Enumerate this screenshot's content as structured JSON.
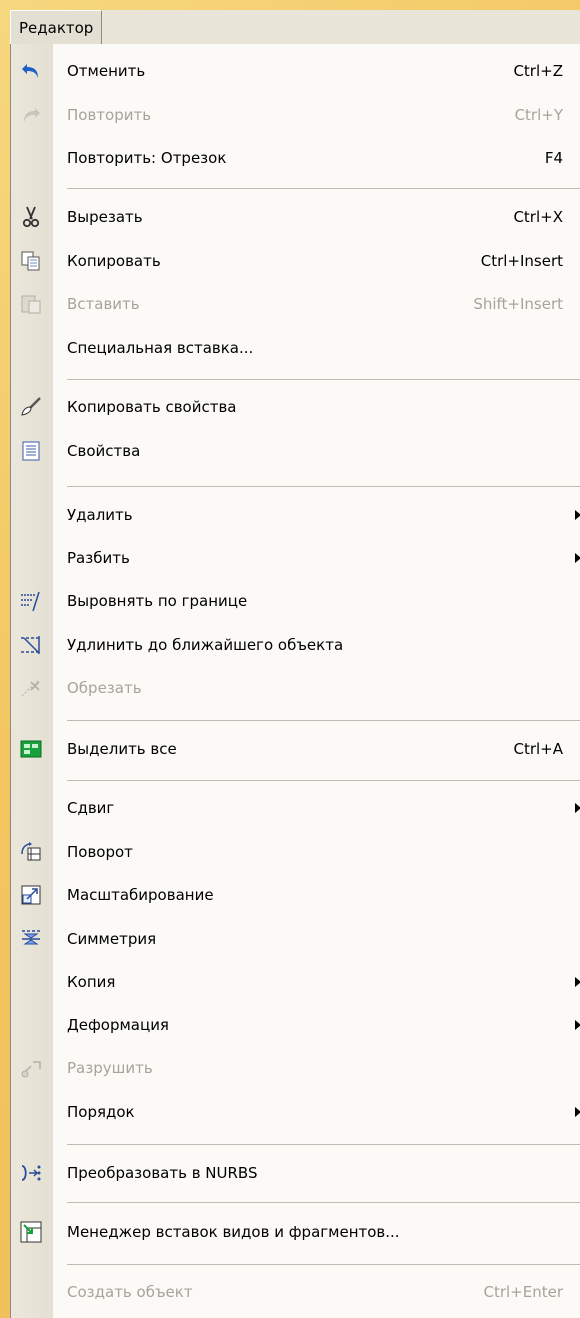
{
  "menubar": {
    "title": "Редактор"
  },
  "colors": {
    "background": "#f3c661",
    "menu": "#fbfaf6",
    "gutter": "#e6e2d6",
    "disabled_text": "#a7a39a",
    "icon_blue": "#1f5fc8",
    "icon_green": "#19a13b"
  },
  "items": [
    {
      "label": "Отменить",
      "shortcut": "Ctrl+Z",
      "icon": "undo-icon",
      "disabled": false,
      "submenu": false
    },
    {
      "label": "Повторить",
      "shortcut": "Ctrl+Y",
      "icon": "redo-icon",
      "disabled": true,
      "submenu": false
    },
    {
      "label": "Повторить: Отрезок",
      "shortcut": "F4",
      "icon": "",
      "disabled": false,
      "submenu": false
    },
    {
      "label": "Вырезать",
      "shortcut": "Ctrl+X",
      "icon": "scissors-icon",
      "disabled": false,
      "submenu": false
    },
    {
      "label": "Копировать",
      "shortcut": "Ctrl+Insert",
      "icon": "copy-icon",
      "disabled": false,
      "submenu": false
    },
    {
      "label": "Вставить",
      "shortcut": "Shift+Insert",
      "icon": "paste-icon",
      "disabled": true,
      "submenu": false
    },
    {
      "label": "Специальная вставка...",
      "shortcut": "",
      "icon": "",
      "disabled": false,
      "submenu": false
    },
    {
      "label": "Копировать свойства",
      "shortcut": "",
      "icon": "brush-icon",
      "disabled": false,
      "submenu": false
    },
    {
      "label": "Свойства",
      "shortcut": "",
      "icon": "properties-icon",
      "disabled": false,
      "submenu": false
    },
    {
      "label": "Удалить",
      "shortcut": "",
      "icon": "",
      "disabled": false,
      "submenu": true
    },
    {
      "label": "Разбить",
      "shortcut": "",
      "icon": "",
      "disabled": false,
      "submenu": true
    },
    {
      "label": "Выровнять по границе",
      "shortcut": "",
      "icon": "align-border-icon",
      "disabled": false,
      "submenu": false
    },
    {
      "label": "Удлинить до ближайшего объекта",
      "shortcut": "",
      "icon": "extend-icon",
      "disabled": false,
      "submenu": false
    },
    {
      "label": "Обрезать",
      "shortcut": "",
      "icon": "trim-icon",
      "disabled": true,
      "submenu": false
    },
    {
      "label": "Выделить все",
      "shortcut": "Ctrl+A",
      "icon": "select-all-icon",
      "disabled": false,
      "submenu": false
    },
    {
      "label": "Сдвиг",
      "shortcut": "",
      "icon": "",
      "disabled": false,
      "submenu": true
    },
    {
      "label": "Поворот",
      "shortcut": "",
      "icon": "rotate-icon",
      "disabled": false,
      "submenu": false
    },
    {
      "label": "Масштабирование",
      "shortcut": "",
      "icon": "scale-icon",
      "disabled": false,
      "submenu": false
    },
    {
      "label": "Симметрия",
      "shortcut": "",
      "icon": "symmetry-icon",
      "disabled": false,
      "submenu": false
    },
    {
      "label": "Копия",
      "shortcut": "",
      "icon": "",
      "disabled": false,
      "submenu": true
    },
    {
      "label": "Деформация",
      "shortcut": "",
      "icon": "",
      "disabled": false,
      "submenu": true
    },
    {
      "label": "Разрушить",
      "shortcut": "",
      "icon": "explode-icon",
      "disabled": true,
      "submenu": false
    },
    {
      "label": "Порядок",
      "shortcut": "",
      "icon": "",
      "disabled": false,
      "submenu": true
    },
    {
      "label": "Преобразовать в NURBS",
      "shortcut": "",
      "icon": "nurbs-icon",
      "disabled": false,
      "submenu": false
    },
    {
      "label": "Менеджер вставок видов и фрагментов...",
      "shortcut": "",
      "icon": "insert-manager-icon",
      "disabled": false,
      "submenu": false
    },
    {
      "label": "Создать объект",
      "shortcut": "Ctrl+Enter",
      "icon": "",
      "disabled": true,
      "submenu": false
    }
  ]
}
